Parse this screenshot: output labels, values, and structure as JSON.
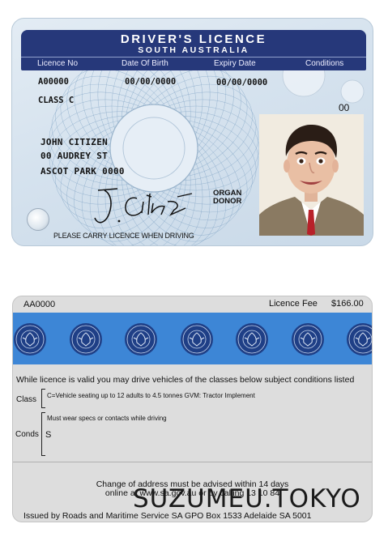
{
  "front": {
    "title": "DRIVER'S LICENCE",
    "subtitle": "SOUTH AUSTRALIA",
    "headers": {
      "licence_no": "Licence No",
      "date_of_birth": "Date Of Birth",
      "expiry_date": "Expiry Date",
      "conditions": "Conditions"
    },
    "licence_no": "A00000",
    "date_of_birth": "00/00/0000",
    "expiry_date": "00/00/0000",
    "licence_class": "CLASS C",
    "conditions_code": "00",
    "holder": {
      "name": "JOHN CITIZEN",
      "address_line1": "00 AUDREY ST",
      "address_line2": "ASCOT PARK 0000"
    },
    "signature": "J. Citizen",
    "organ_donor_line1": "ORGAN",
    "organ_donor_line2": "DONOR",
    "carry_notice": "PLEASE CARRY LICENCE WHEN DRIVING"
  },
  "back": {
    "licence_no": "AA0000",
    "fee_label": "Licence Fee",
    "fee_value": "$166.00",
    "valid_statement": "While licence is valid you may drive vehicles of the classes below subject conditions listed",
    "class_label": "Class",
    "class_text": "C=Vehicle seating up to 12 adults to 4.5 tonnes GVM: Tractor Implement",
    "conds_label": "Conds",
    "conds_text": "Must wear specs or contacts while driving",
    "conds_value": "S",
    "change_line1": "Change of address must be advised within 14 days",
    "change_line2": "online at www.sa.gov.au or by calling 13 10 84",
    "issued_by": "Issued by Roads and Maritime Service SA GPO Box 1533 Adelaide SA 5001"
  },
  "watermark": "SUZUMEU.TOKYO",
  "colors": {
    "banner": "#26387a",
    "band": "#3d86d6",
    "seal": "#1f3f86"
  }
}
